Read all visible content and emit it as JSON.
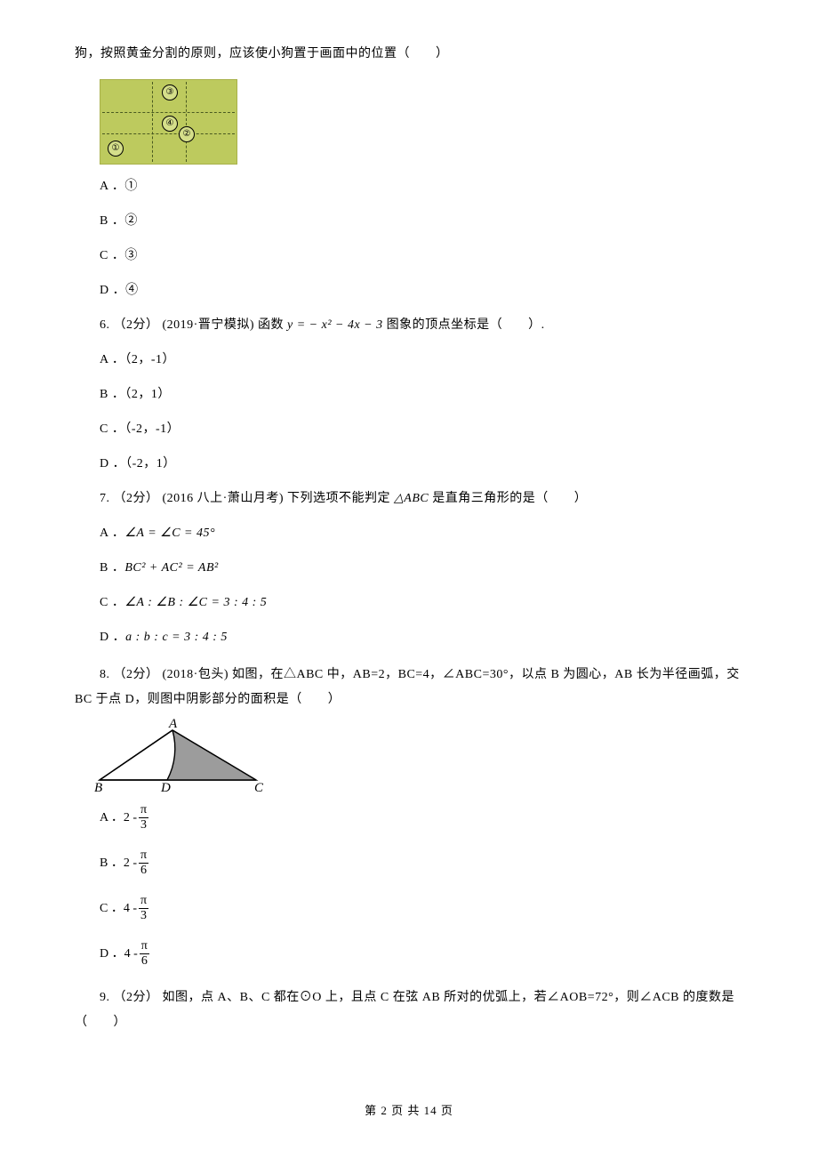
{
  "q5": {
    "stem_cont": "狗，按照黄金分割的原则，应该使小狗置于画面中的位置（　　）",
    "markers": [
      "③",
      "④",
      "②",
      "①"
    ],
    "options": {
      "A": "①",
      "B": "②",
      "C": "③",
      "D": "④"
    }
  },
  "q6": {
    "stem_prefix": "6. （2分） (2019·晋宁模拟) 函数 ",
    "formula": "y = − x² − 4x − 3",
    "stem_suffix": " 图象的顶点坐标是（　　）.",
    "options": {
      "A": "（2，-1）",
      "B": "（2，1）",
      "C": "（-2，-1）",
      "D": "（-2，1）"
    }
  },
  "q7": {
    "stem_prefix": "7. （2分） (2016 八上·萧山月考) 下列选项不能判定 ",
    "tri": "△ABC",
    "stem_suffix": " 是直角三角形的是（　　）",
    "options": {
      "A": "∠A = ∠C = 45°",
      "B": "BC² + AC² = AB²",
      "C": "∠A : ∠B : ∠C = 3 : 4 : 5",
      "D": "a : b : c = 3 : 4 : 5"
    }
  },
  "q8": {
    "stem": "8. （2分） (2018·包头) 如图，在△ABC 中，AB=2，BC=4，∠ABC=30°，以点 B 为圆心，AB 长为半径画弧，交 BC 于点 D，则图中阴影部分的面积是（　　）",
    "labels": {
      "A": "A",
      "B": "B",
      "C": "C",
      "D": "D"
    },
    "options": {
      "A": {
        "lead": "A ．2 - ",
        "num": "π",
        "den": "3"
      },
      "B": {
        "lead": "B ．2 - ",
        "num": "π",
        "den": "6"
      },
      "C": {
        "lead": "C ．4 - ",
        "num": "π",
        "den": "3"
      },
      "D": {
        "lead": "D ．4 - ",
        "num": "π",
        "den": "6"
      }
    }
  },
  "q9": {
    "stem": "9. （2分） 如图，点 A、B、C 都在⊙O 上，且点 C 在弦 AB 所对的优弧上，若∠AOB=72°，则∠ACB  的度数是（　　）"
  },
  "footer": {
    "prefix": "第 ",
    "page": "2",
    "mid": " 页 共 ",
    "total": "14",
    "suffix": " 页"
  }
}
